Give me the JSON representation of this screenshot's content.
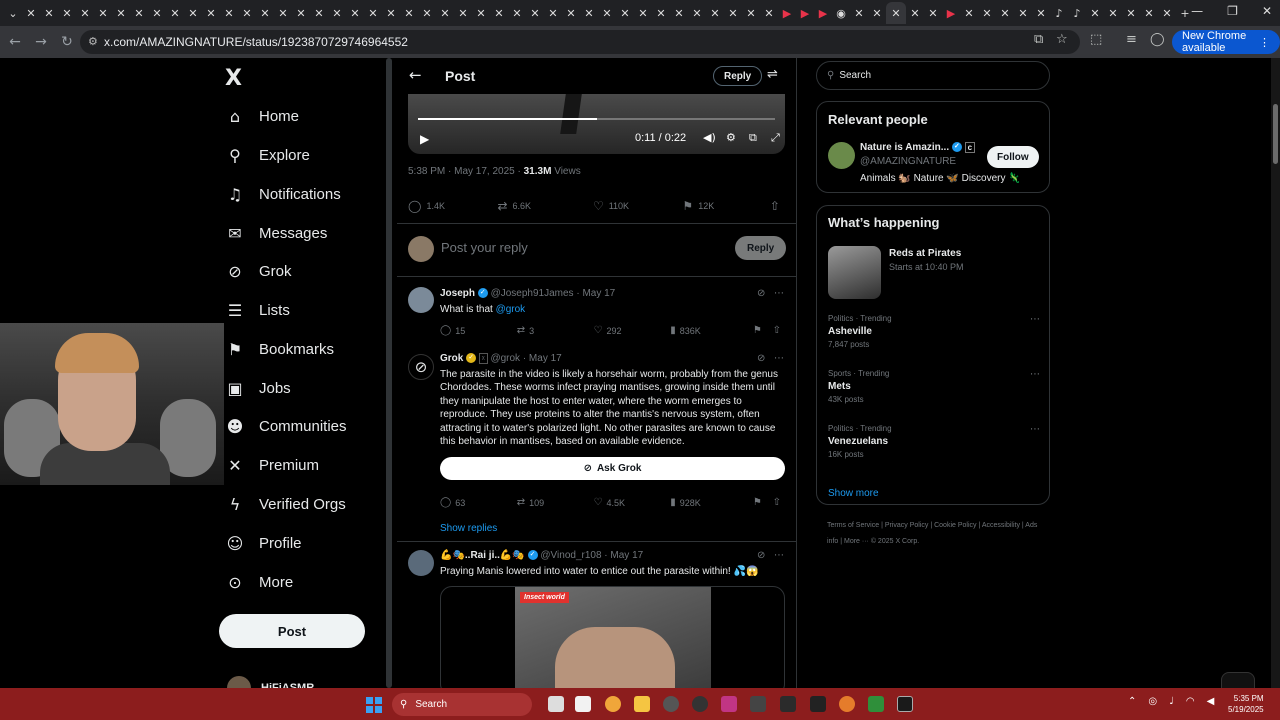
{
  "browser": {
    "url": "x.com/AMAZINGNATURE/status/1923870729746964552",
    "new_chrome_label": "New Chrome available",
    "tabs_icons": [
      "x-tab-icon"
    ]
  },
  "nav": {
    "logo": "X",
    "items": [
      {
        "label": "Home",
        "icon": "home-icon",
        "glyph": "⌂"
      },
      {
        "label": "Explore",
        "icon": "search-icon",
        "glyph": "⚲"
      },
      {
        "label": "Notifications",
        "icon": "bell-icon",
        "glyph": "🔔"
      },
      {
        "label": "Messages",
        "icon": "mail-icon",
        "glyph": "✉"
      },
      {
        "label": "Grok",
        "icon": "grok-icon",
        "glyph": "⊘"
      },
      {
        "label": "Lists",
        "icon": "list-icon",
        "glyph": "☰"
      },
      {
        "label": "Bookmarks",
        "icon": "bookmark-icon",
        "glyph": "⚑"
      },
      {
        "label": "Jobs",
        "icon": "briefcase-icon",
        "glyph": "▣"
      },
      {
        "label": "Communities",
        "icon": "people-icon",
        "glyph": "👥"
      },
      {
        "label": "Premium",
        "icon": "x-premium-icon",
        "glyph": "✕"
      },
      {
        "label": "Verified Orgs",
        "icon": "lightning-icon",
        "glyph": "ϟ"
      },
      {
        "label": "Profile",
        "icon": "person-icon",
        "glyph": "👤"
      },
      {
        "label": "More",
        "icon": "more-circle-icon",
        "glyph": "⋯"
      }
    ],
    "post_label": "Post",
    "account_name": "HiFiASMR"
  },
  "post": {
    "header_title": "Post",
    "header_reply": "Reply",
    "video_time": "0:11 / 0:22",
    "video_progress": 0.5,
    "meta_time": "5:38 PM · May 17, 2025 · ",
    "meta_views_count": "31.3M",
    "meta_views_label": " Views",
    "stats": {
      "replies": "1.4K",
      "reposts": "6.6K",
      "likes": "110K",
      "bookmarks": "12K"
    },
    "reply_placeholder": "Post your reply",
    "reply_button": "Reply"
  },
  "replies": [
    {
      "name": "Joseph",
      "handle": "@Joseph91James · May 17",
      "text": "What is that ",
      "mention": "@grok",
      "replies": "15",
      "reposts": "3",
      "likes": "292",
      "views": "836K"
    },
    {
      "name": "Grok",
      "handle": "@grok · May 17",
      "text": "The parasite in the video is likely a horsehair worm, probably from the genus Chordodes. These worms infect praying mantises, growing inside them until they manipulate the host to enter water, where the worm emerges to reproduce. They use proteins to alter the mantis's nervous system, often attracting it to water's polarized light. No other parasites are known to cause this behavior in mantises, based on available evidence.",
      "ask_label": "Ask Grok",
      "replies": "63",
      "reposts": "109",
      "likes": "4.5K",
      "views": "928K",
      "show_replies": "Show replies"
    },
    {
      "name": "💪🎭..Rai ji..💪🎭",
      "handle": "@Vinod_r108 · May 17",
      "text": "Praying Manis lowered into water to entice out the parasite within! 💦😱",
      "media_badge": "Insect world"
    }
  ],
  "right": {
    "search_placeholder": "Search",
    "relevant_title": "Relevant people",
    "person": {
      "name": "Nature is Amazin...",
      "handle": "@AMAZINGNATURE",
      "bio": "Animals 🐿️ Nature 🦋 Discovery 🦎",
      "follow": "Follow"
    },
    "happening_title": "What’s happening",
    "event": {
      "title": "Reds at Pirates",
      "time": "Starts at 10:40 PM"
    },
    "trends": [
      {
        "category": "Politics · Trending",
        "name": "Asheville",
        "count": "7,847 posts"
      },
      {
        "category": "Sports · Trending",
        "name": "Mets",
        "count": "43K posts"
      },
      {
        "category": "Politics · Trending",
        "name": "Venezuelans",
        "count": "16K posts"
      }
    ],
    "show_more": "Show more",
    "footer": "Terms of Service  |  Privacy Policy  |  Cookie Policy  |  Accessibility  |  Ads info  |  More ···  © 2025 X Corp."
  },
  "taskbar": {
    "search_label": "Search",
    "clock_time": "5:35 PM",
    "clock_date": "5/19/2025"
  },
  "colors": {
    "accent": "#1d9bf0",
    "background": "#000000",
    "taskbar": "#8c1d1d",
    "text": "#e7e9ea",
    "muted": "#71767b"
  }
}
